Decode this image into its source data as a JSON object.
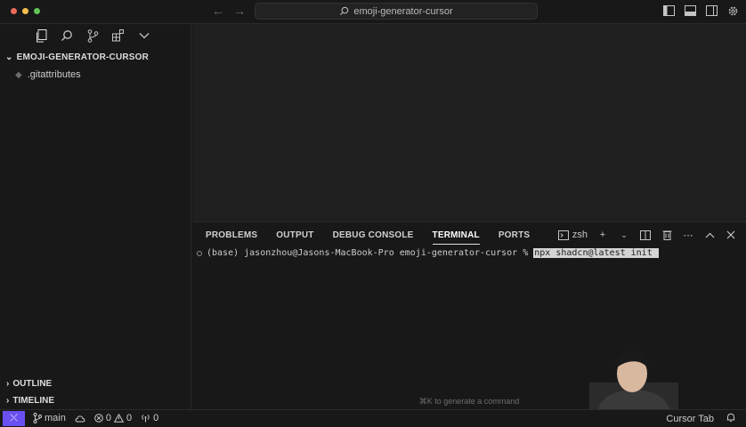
{
  "titlebar": {
    "search_text": "emoji-generator-cursor",
    "traffic_colors": [
      "#ed6a5e",
      "#f5bf4f",
      "#61c554"
    ]
  },
  "sidebar": {
    "root_folder": "EMOJI-GENERATOR-CURSOR",
    "files": [
      ".gitattributes"
    ],
    "outline_label": "OUTLINE",
    "timeline_label": "TIMELINE"
  },
  "panel": {
    "tabs": [
      "PROBLEMS",
      "OUTPUT",
      "DEBUG CONSOLE",
      "TERMINAL",
      "PORTS"
    ],
    "active_tab": "TERMINAL",
    "shell": "zsh",
    "prompt": "(base) jasonzhou@Jasons-MacBook-Pro emoji-generator-cursor % ",
    "command": "npx shadcn@latest init ",
    "hint": "⌘K to generate a command"
  },
  "statusbar": {
    "branch": "main",
    "errors": "0",
    "warnings": "0",
    "ports": "0",
    "cursor_tab": "Cursor Tab",
    "accent": "#6a4ff2"
  }
}
